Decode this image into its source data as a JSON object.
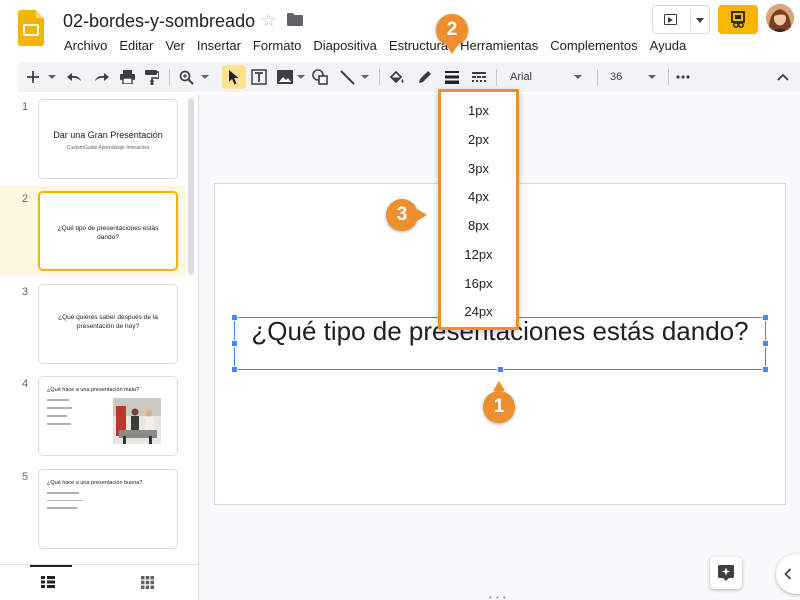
{
  "app": {
    "doc_title": "02-bordes-y-sombreado",
    "accent": "#f9b600",
    "callout_color": "#ee8f2e",
    "selection_color": "#4a86e8"
  },
  "menu": [
    "Archivo",
    "Editar",
    "Ver",
    "Insertar",
    "Formato",
    "Diapositiva",
    "Estructura",
    "Herramientas",
    "Complementos",
    "Ayuda"
  ],
  "toolbar": {
    "font_name": "Arial",
    "font_size": "36"
  },
  "slides": [
    {
      "num": "1",
      "title": "Dar una Gran Presentación",
      "subtitle": "CustomGuide Aprendizaje Interactivo"
    },
    {
      "num": "2",
      "title": "¿Qué tipo de presentaciones estás dando?"
    },
    {
      "num": "3",
      "title": "¿Qué quieres saber después de la presentación de hoy?"
    },
    {
      "num": "4",
      "title": "¿Qué hace a una presentación mala?"
    },
    {
      "num": "5",
      "title": "¿Qué hace a una presentación buena?"
    }
  ],
  "canvas": {
    "text": "¿Qué tipo de presentaciones estás dando?"
  },
  "dropdown": {
    "options": [
      "1px",
      "2px",
      "3px",
      "4px",
      "8px",
      "12px",
      "16px",
      "24px"
    ]
  },
  "callouts": {
    "c1": "1",
    "c2": "2",
    "c3": "3"
  }
}
